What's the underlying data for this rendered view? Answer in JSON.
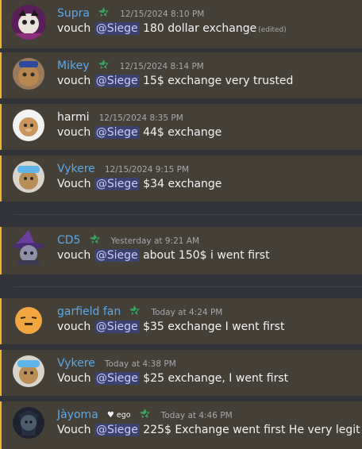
{
  "messages": [
    {
      "author": "Supra",
      "verified": true,
      "timestamp": "12/15/2024 8:10 PM",
      "prefix": "vouch ",
      "mention": "@Siege",
      "text": " 180 dollar exchange",
      "edited": "(edited)"
    },
    {
      "author": "Mikey",
      "verified": true,
      "timestamp": "12/15/2024 8:14 PM",
      "prefix": "vouch ",
      "mention": "@Siege",
      "text": " 15$ exchange very trusted"
    },
    {
      "author": "harmi",
      "verified": false,
      "timestamp": "12/15/2024 8:35 PM",
      "prefix": "vouch ",
      "mention": "@Siege",
      "text": " 44$ exchange"
    },
    {
      "author": "Vykere",
      "verified": false,
      "timestamp": "12/15/2024 9:15 PM",
      "prefix": "Vouch ",
      "mention": "@Siege",
      "text": " $34 exchange"
    },
    {
      "author": "CD5",
      "verified": true,
      "timestamp": "Yesterday at 9:21 AM",
      "prefix": "vouch ",
      "mention": "@Siege",
      "text": " about 150$ i went first"
    },
    {
      "author": "garfield fan",
      "verified": true,
      "timestamp": "Today at 4:24 PM",
      "prefix": "vouch ",
      "mention": "@Siege",
      "text": " $35 exchange I went first"
    },
    {
      "author": "Vykere",
      "verified": false,
      "timestamp": "Today at 4:38 PM",
      "prefix": "Vouch ",
      "mention": "@Siege",
      "text": " $25 exchange, I went first"
    },
    {
      "author": "Jàyoma",
      "verified": true,
      "tag": "ego",
      "timestamp": "Today at 4:46 PM",
      "prefix": "Vouch ",
      "mention": "@Siege",
      "text": " 225$ Exchange went first He very legit"
    }
  ],
  "colors": {
    "highlight": "#444037",
    "accent_bar": "#f0b232",
    "mention_bg": "#3c4270",
    "username": "#5ca8e9",
    "badge": "#3ba55c"
  }
}
